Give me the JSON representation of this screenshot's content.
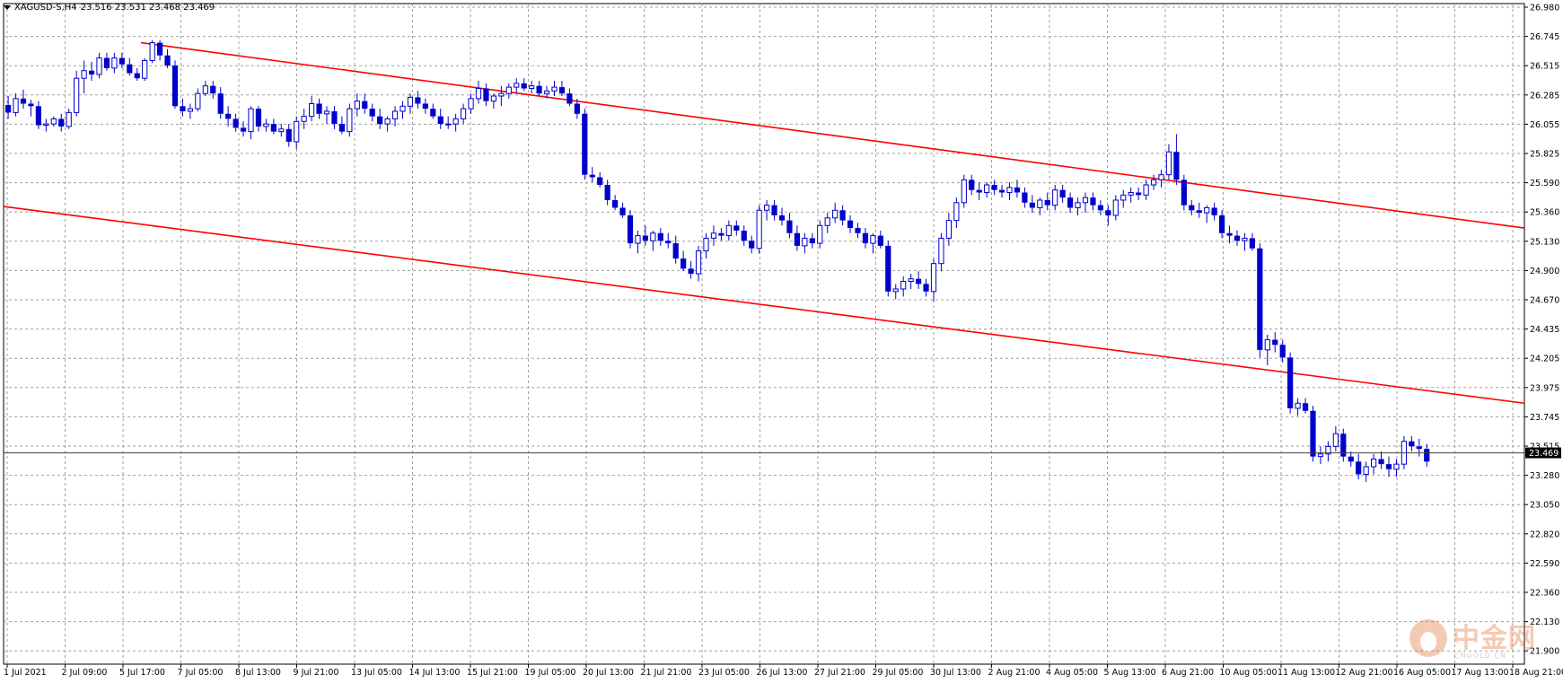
{
  "header": {
    "symbol": "XAGUSD-S,H4",
    "ohlc": "23.516 23.531 23.468 23.469"
  },
  "colors": {
    "candle": "#0000cc",
    "channel": "#ff0000",
    "grid": "#a0a0a0",
    "axis": "#000000",
    "bid_line": "#404040"
  },
  "current_price": "23.469",
  "watermark": {
    "text": "中金网",
    "sub": "CNGOLD.CN"
  },
  "chart_data": {
    "type": "candlestick",
    "timeframe": "H4",
    "y_ticks": [
      "26.980",
      "26.745",
      "26.515",
      "26.285",
      "26.055",
      "25.825",
      "25.590",
      "25.360",
      "25.130",
      "24.900",
      "24.670",
      "24.435",
      "24.205",
      "23.975",
      "23.745",
      "23.515",
      "23.280",
      "23.050",
      "22.820",
      "22.590",
      "22.360",
      "22.130",
      "21.900"
    ],
    "ylim": [
      21.795,
      27.04
    ],
    "x_labels": [
      "1 Jul 2021",
      "2 Jul 09:00",
      "5 Jul 17:00",
      "7 Jul 05:00",
      "8 Jul 13:00",
      "9 Jul 21:00",
      "13 Jul 05:00",
      "14 Jul 13:00",
      "15 Jul 21:00",
      "19 Jul 05:00",
      "20 Jul 13:00",
      "21 Jul 21:00",
      "23 Jul 05:00",
      "26 Jul 13:00",
      "27 Jul 21:00",
      "29 Jul 05:00",
      "30 Jul 13:00",
      "2 Aug 21:00",
      "4 Aug 05:00",
      "5 Aug 13:00",
      "6 Aug 21:00",
      "10 Aug 05:00",
      "11 Aug 13:00",
      "12 Aug 21:00",
      "16 Aug 05:00",
      "17 Aug 13:00",
      "18 Aug 21:00"
    ],
    "bar_count": 204,
    "candles": [
      [
        26.21,
        26.28,
        26.1,
        26.15
      ],
      [
        26.15,
        26.3,
        26.12,
        26.26
      ],
      [
        26.26,
        26.33,
        26.18,
        26.22
      ],
      [
        26.22,
        26.25,
        26.12,
        26.2
      ],
      [
        26.2,
        26.24,
        26.02,
        26.05
      ],
      [
        26.05,
        26.1,
        26.0,
        26.06
      ],
      [
        26.06,
        26.12,
        26.04,
        26.1
      ],
      [
        26.1,
        26.14,
        26.0,
        26.04
      ],
      [
        26.04,
        26.18,
        26.02,
        26.15
      ],
      [
        26.15,
        26.48,
        26.12,
        26.42
      ],
      [
        26.42,
        26.56,
        26.3,
        26.48
      ],
      [
        26.48,
        26.55,
        26.4,
        26.45
      ],
      [
        26.45,
        26.62,
        26.42,
        26.58
      ],
      [
        26.58,
        26.62,
        26.48,
        26.5
      ],
      [
        26.5,
        26.62,
        26.46,
        26.58
      ],
      [
        26.58,
        26.62,
        26.5,
        26.53
      ],
      [
        26.53,
        26.58,
        26.44,
        26.46
      ],
      [
        26.46,
        26.5,
        26.4,
        26.42
      ],
      [
        26.42,
        26.58,
        26.4,
        26.56
      ],
      [
        26.56,
        26.72,
        26.54,
        26.7
      ],
      [
        26.7,
        26.72,
        26.56,
        26.6
      ],
      [
        26.6,
        26.65,
        26.5,
        26.52
      ],
      [
        26.52,
        26.56,
        26.18,
        26.2
      ],
      [
        26.2,
        26.26,
        26.12,
        26.16
      ],
      [
        26.16,
        26.22,
        26.1,
        26.18
      ],
      [
        26.18,
        26.34,
        26.16,
        26.3
      ],
      [
        26.3,
        26.4,
        26.28,
        26.36
      ],
      [
        26.36,
        26.4,
        26.26,
        26.3
      ],
      [
        26.3,
        26.35,
        26.1,
        26.14
      ],
      [
        26.14,
        26.2,
        26.04,
        26.1
      ],
      [
        26.1,
        26.14,
        26.0,
        26.03
      ],
      [
        26.03,
        26.08,
        25.96,
        26.0
      ],
      [
        26.0,
        26.2,
        25.94,
        26.18
      ],
      [
        26.18,
        26.2,
        26.0,
        26.04
      ],
      [
        26.04,
        26.1,
        26.0,
        26.06
      ],
      [
        26.06,
        26.1,
        25.98,
        26.0
      ],
      [
        26.0,
        26.06,
        25.96,
        26.02
      ],
      [
        26.02,
        26.06,
        25.88,
        25.92
      ],
      [
        25.92,
        26.12,
        25.86,
        26.08
      ],
      [
        26.08,
        26.18,
        26.02,
        26.12
      ],
      [
        26.12,
        26.28,
        26.08,
        26.22
      ],
      [
        26.22,
        26.26,
        26.1,
        26.14
      ],
      [
        26.14,
        26.2,
        26.06,
        26.16
      ],
      [
        26.16,
        26.2,
        26.02,
        26.06
      ],
      [
        26.06,
        26.12,
        25.98,
        26.0
      ],
      [
        26.0,
        26.22,
        25.96,
        26.18
      ],
      [
        26.18,
        26.3,
        26.12,
        26.24
      ],
      [
        26.24,
        26.3,
        26.14,
        26.18
      ],
      [
        26.18,
        26.22,
        26.08,
        26.12
      ],
      [
        26.12,
        26.18,
        26.02,
        26.06
      ],
      [
        26.06,
        26.12,
        26.0,
        26.1
      ],
      [
        26.1,
        26.2,
        26.04,
        26.16
      ],
      [
        26.16,
        26.24,
        26.1,
        26.2
      ],
      [
        26.2,
        26.3,
        26.14,
        26.27
      ],
      [
        26.27,
        26.32,
        26.18,
        26.22
      ],
      [
        26.22,
        26.26,
        26.14,
        26.18
      ],
      [
        26.18,
        26.22,
        26.1,
        26.12
      ],
      [
        26.12,
        26.18,
        26.02,
        26.06
      ],
      [
        26.06,
        26.12,
        26.02,
        26.06
      ],
      [
        26.06,
        26.14,
        26.0,
        26.1
      ],
      [
        26.1,
        26.22,
        26.06,
        26.18
      ],
      [
        26.18,
        26.3,
        26.14,
        26.26
      ],
      [
        26.26,
        26.4,
        26.22,
        26.34
      ],
      [
        26.34,
        26.38,
        26.2,
        26.24
      ],
      [
        26.24,
        26.3,
        26.18,
        26.28
      ],
      [
        26.28,
        26.36,
        26.2,
        26.3
      ],
      [
        26.3,
        26.38,
        26.26,
        26.35
      ],
      [
        26.35,
        26.42,
        26.3,
        26.38
      ],
      [
        26.38,
        26.42,
        26.32,
        26.34
      ],
      [
        26.34,
        26.4,
        26.3,
        26.36
      ],
      [
        26.36,
        26.4,
        26.28,
        26.3
      ],
      [
        26.3,
        26.36,
        26.26,
        26.32
      ],
      [
        26.32,
        26.4,
        26.28,
        26.35
      ],
      [
        26.35,
        26.4,
        26.28,
        26.3
      ],
      [
        26.3,
        26.34,
        26.2,
        26.22
      ],
      [
        26.22,
        26.26,
        26.1,
        26.14
      ],
      [
        26.14,
        26.18,
        25.62,
        25.66
      ],
      [
        25.66,
        25.72,
        25.6,
        25.64
      ],
      [
        25.64,
        25.68,
        25.56,
        25.58
      ],
      [
        25.58,
        25.62,
        25.42,
        25.46
      ],
      [
        25.46,
        25.5,
        25.38,
        25.4
      ],
      [
        25.4,
        25.44,
        25.32,
        25.34
      ],
      [
        25.34,
        25.38,
        25.08,
        25.12
      ],
      [
        25.12,
        25.22,
        25.04,
        25.18
      ],
      [
        25.18,
        25.26,
        25.1,
        25.14
      ],
      [
        25.14,
        25.22,
        25.06,
        25.2
      ],
      [
        25.2,
        25.24,
        25.1,
        25.14
      ],
      [
        25.14,
        25.2,
        25.08,
        25.12
      ],
      [
        25.12,
        25.18,
        24.96,
        25.0
      ],
      [
        25.0,
        25.06,
        24.9,
        24.92
      ],
      [
        24.92,
        24.98,
        24.84,
        24.88
      ],
      [
        24.88,
        25.1,
        24.82,
        25.06
      ],
      [
        25.06,
        25.2,
        25.0,
        25.16
      ],
      [
        25.16,
        25.26,
        25.1,
        25.2
      ],
      [
        25.2,
        25.24,
        25.14,
        25.18
      ],
      [
        25.18,
        25.3,
        25.14,
        25.26
      ],
      [
        25.26,
        25.3,
        25.18,
        25.22
      ],
      [
        25.22,
        25.26,
        25.1,
        25.14
      ],
      [
        25.14,
        25.18,
        25.04,
        25.08
      ],
      [
        25.08,
        25.42,
        25.04,
        25.38
      ],
      [
        25.38,
        25.46,
        25.3,
        25.42
      ],
      [
        25.42,
        25.46,
        25.3,
        25.34
      ],
      [
        25.34,
        25.4,
        25.26,
        25.3
      ],
      [
        25.3,
        25.36,
        25.16,
        25.2
      ],
      [
        25.2,
        25.26,
        25.06,
        25.1
      ],
      [
        25.1,
        25.2,
        25.04,
        25.16
      ],
      [
        25.16,
        25.2,
        25.08,
        25.12
      ],
      [
        25.12,
        25.3,
        25.08,
        25.26
      ],
      [
        25.26,
        25.36,
        25.2,
        25.32
      ],
      [
        25.32,
        25.44,
        25.28,
        25.38
      ],
      [
        25.38,
        25.42,
        25.26,
        25.3
      ],
      [
        25.3,
        25.34,
        25.2,
        25.24
      ],
      [
        25.24,
        25.28,
        25.16,
        25.2
      ],
      [
        25.2,
        25.24,
        25.08,
        25.12
      ],
      [
        25.12,
        25.2,
        25.04,
        25.18
      ],
      [
        25.18,
        25.22,
        25.08,
        25.1
      ],
      [
        25.1,
        25.14,
        24.7,
        24.74
      ],
      [
        24.74,
        24.8,
        24.68,
        24.76
      ],
      [
        24.76,
        24.86,
        24.7,
        24.82
      ],
      [
        24.82,
        24.88,
        24.76,
        24.84
      ],
      [
        24.84,
        24.9,
        24.76,
        24.8
      ],
      [
        24.8,
        24.84,
        24.7,
        24.74
      ],
      [
        24.74,
        25.0,
        24.66,
        24.96
      ],
      [
        24.96,
        25.2,
        24.9,
        25.16
      ],
      [
        25.16,
        25.36,
        25.1,
        25.3
      ],
      [
        25.3,
        25.48,
        25.24,
        25.44
      ],
      [
        25.44,
        25.66,
        25.4,
        25.62
      ],
      [
        25.62,
        25.66,
        25.5,
        25.54
      ],
      [
        25.54,
        25.6,
        25.46,
        25.52
      ],
      [
        25.52,
        25.6,
        25.48,
        25.58
      ],
      [
        25.58,
        25.62,
        25.5,
        25.54
      ],
      [
        25.54,
        25.58,
        25.48,
        25.52
      ],
      [
        25.52,
        25.6,
        25.46,
        25.56
      ],
      [
        25.56,
        25.62,
        25.48,
        25.52
      ],
      [
        25.52,
        25.56,
        25.4,
        25.44
      ],
      [
        25.44,
        25.5,
        25.36,
        25.4
      ],
      [
        25.4,
        25.48,
        25.34,
        25.46
      ],
      [
        25.46,
        25.52,
        25.38,
        25.42
      ],
      [
        25.42,
        25.58,
        25.38,
        25.54
      ],
      [
        25.54,
        25.58,
        25.44,
        25.48
      ],
      [
        25.48,
        25.52,
        25.36,
        25.4
      ],
      [
        25.4,
        25.48,
        25.34,
        25.44
      ],
      [
        25.44,
        25.52,
        25.36,
        25.48
      ],
      [
        25.48,
        25.52,
        25.38,
        25.42
      ],
      [
        25.42,
        25.46,
        25.34,
        25.38
      ],
      [
        25.38,
        25.42,
        25.26,
        25.34
      ],
      [
        25.34,
        25.5,
        25.3,
        25.46
      ],
      [
        25.46,
        25.54,
        25.4,
        25.5
      ],
      [
        25.5,
        25.56,
        25.44,
        25.52
      ],
      [
        25.52,
        25.56,
        25.46,
        25.5
      ],
      [
        25.5,
        25.62,
        25.46,
        25.58
      ],
      [
        25.58,
        25.66,
        25.54,
        25.62
      ],
      [
        25.62,
        25.7,
        25.56,
        25.66
      ],
      [
        25.66,
        25.9,
        25.62,
        25.84
      ],
      [
        25.84,
        25.98,
        25.58,
        25.62
      ],
      [
        25.62,
        25.66,
        25.38,
        25.42
      ],
      [
        25.42,
        25.46,
        25.34,
        25.38
      ],
      [
        25.38,
        25.44,
        25.32,
        25.36
      ],
      [
        25.36,
        25.42,
        25.28,
        25.4
      ],
      [
        25.4,
        25.44,
        25.3,
        25.34
      ],
      [
        25.34,
        25.38,
        25.16,
        25.2
      ],
      [
        25.2,
        25.26,
        25.12,
        25.18
      ],
      [
        25.18,
        25.22,
        25.1,
        25.14
      ],
      [
        25.14,
        25.2,
        25.06,
        25.16
      ],
      [
        25.16,
        25.2,
        25.06,
        25.08
      ],
      [
        25.08,
        25.12,
        24.22,
        24.28
      ],
      [
        24.28,
        24.4,
        24.16,
        24.36
      ],
      [
        24.36,
        24.42,
        24.26,
        24.32
      ],
      [
        24.32,
        24.36,
        24.18,
        24.22
      ],
      [
        24.22,
        24.26,
        23.78,
        23.82
      ],
      [
        23.82,
        23.9,
        23.76,
        23.86
      ],
      [
        23.86,
        23.9,
        23.78,
        23.8
      ],
      [
        23.8,
        23.84,
        23.4,
        23.44
      ],
      [
        23.44,
        23.52,
        23.38,
        23.46
      ],
      [
        23.46,
        23.56,
        23.4,
        23.52
      ],
      [
        23.52,
        23.68,
        23.48,
        23.62
      ],
      [
        23.62,
        23.66,
        23.4,
        23.44
      ],
      [
        23.44,
        23.48,
        23.36,
        23.4
      ],
      [
        23.4,
        23.46,
        23.26,
        23.3
      ],
      [
        23.3,
        23.4,
        23.24,
        23.36
      ],
      [
        23.36,
        23.46,
        23.3,
        23.42
      ],
      [
        23.42,
        23.48,
        23.34,
        23.38
      ],
      [
        23.38,
        23.44,
        23.28,
        23.34
      ],
      [
        23.34,
        23.42,
        23.28,
        23.38
      ],
      [
        23.38,
        23.6,
        23.34,
        23.56
      ],
      [
        23.56,
        23.6,
        23.48,
        23.52
      ],
      [
        23.52,
        23.58,
        23.44,
        23.5
      ],
      [
        23.5,
        23.54,
        23.36,
        23.4
      ]
    ],
    "channel_upper": {
      "x1": "5 Jul 17:00",
      "y1": 26.7,
      "x2": "18 Aug 21:00",
      "y2": 25.24
    },
    "channel_lower": {
      "y_left": 25.41,
      "y_mid": 24.26,
      "y_right": 23.86
    },
    "grid": true
  }
}
